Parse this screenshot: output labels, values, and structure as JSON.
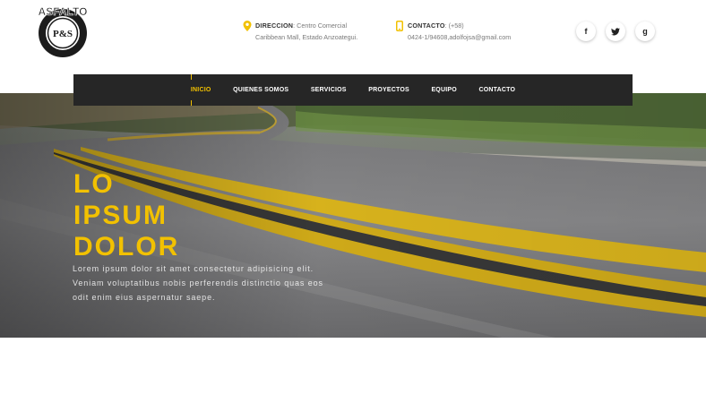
{
  "brand": {
    "logo_text": "ASFALTO",
    "logo_initials": "P&S"
  },
  "header": {
    "address": {
      "icon": "location-pin-icon",
      "label": "DIRECCION",
      "line1": ": Centro Comercial",
      "line2": "Caribbean Mall, Estado Anzoategui."
    },
    "contact": {
      "icon": "phone-icon",
      "label": "CONTACTO",
      "line1": ": (+58)",
      "line2": "0424-1/94608,adolfojsa@gmail.com"
    },
    "social": [
      {
        "name": "facebook-icon",
        "glyph": "f"
      },
      {
        "name": "twitter-icon",
        "glyph": "t"
      },
      {
        "name": "google-plus-icon",
        "glyph": "g"
      }
    ]
  },
  "nav": {
    "items": [
      "INICIO",
      "QUIENES SOMOS",
      "SERVICIOS",
      "PROYECTOS",
      "EQUIPO",
      "CONTACTO"
    ],
    "active_index": 0
  },
  "hero": {
    "title_lines": [
      "LO",
      "IPSUM",
      "DOLOR"
    ],
    "text_lines": [
      "Lorem ipsum dolor sit amet consectetur adipisicing elit.",
      "Veniam voluptatibus nobis perferendis distinctio quas eos",
      "odit enim eius aspernatur saepe."
    ]
  },
  "colors": {
    "accent": "#f2c100",
    "nav_bg": "#262626"
  }
}
